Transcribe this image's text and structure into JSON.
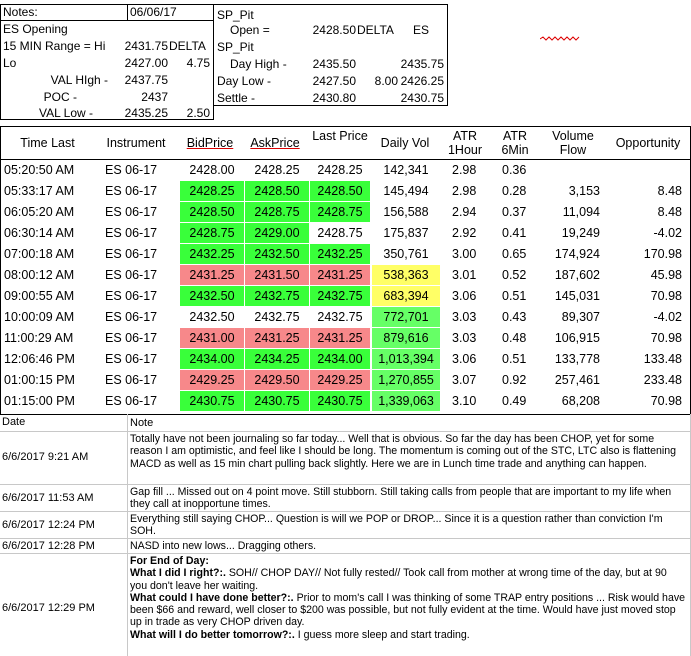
{
  "header": {
    "notes_label": "Notes:",
    "date": "06/06/17",
    "left": [
      {
        "label": "ES Opening",
        "v1": "",
        "v2": ""
      },
      {
        "label": "15 MIN Range = Hi",
        "v1": "2431.75",
        "v2": "DELTA"
      },
      {
        "label": "Lo",
        "v1": "2427.00",
        "v2": "4.75"
      },
      {
        "label": "VAL HIgh  -",
        "v1": "2437.75",
        "v2": ""
      },
      {
        "label": "POC  -",
        "v1": "2437",
        "v2": ""
      },
      {
        "label": "VAL Low  -",
        "v1": "2435.25",
        "v2": "2.50"
      }
    ],
    "right": {
      "title": "SP_Pit",
      "open_label": "Open =",
      "open_value": "2428.50",
      "delta_label": "DELTA",
      "es_label": "ES",
      "title2": "SP_Pit",
      "rows": [
        {
          "label": "Day High -",
          "v1": "2435.50",
          "v2": "",
          "v3": "2435.75"
        },
        {
          "label": "Day Low -",
          "v1": "2427.50",
          "v2": "8.00",
          "v3": "2426.25"
        },
        {
          "label": "Settle -",
          "v1": "2430.80",
          "v2": "",
          "v3": "2430.75"
        }
      ]
    }
  },
  "quotes": {
    "columns": [
      "Time Last",
      "Instrument",
      "BidPrice",
      "AskPrice",
      "Last Price",
      "Daily Vol",
      "ATR 1Hour",
      "ATR 6Min",
      "Volume Flow",
      "Opportunity"
    ],
    "rows": [
      {
        "time": "05:20:50 AM",
        "inst": "ES 06-17",
        "bid": "2428.00",
        "ask": "2428.25",
        "last": "2428.25",
        "vol": "142,341",
        "atr1": "2.98",
        "atr6": "0.36",
        "flow": "",
        "opp": "",
        "c": [
          "",
          "",
          "",
          ""
        ]
      },
      {
        "time": "05:33:17 AM",
        "inst": "ES 06-17",
        "bid": "2428.25",
        "ask": "2428.50",
        "last": "2428.50",
        "vol": "145,494",
        "atr1": "2.98",
        "atr6": "0.28",
        "flow": "3,153",
        "opp": "8.48",
        "c": [
          "green",
          "green",
          "green",
          ""
        ]
      },
      {
        "time": "06:05:20 AM",
        "inst": "ES 06-17",
        "bid": "2428.50",
        "ask": "2428.75",
        "last": "2428.75",
        "vol": "156,588",
        "atr1": "2.94",
        "atr6": "0.37",
        "flow": "11,094",
        "opp": "8.48",
        "c": [
          "green",
          "green",
          "green",
          ""
        ]
      },
      {
        "time": "06:30:14 AM",
        "inst": "ES 06-17",
        "bid": "2428.75",
        "ask": "2429.00",
        "last": "2428.75",
        "vol": "175,837",
        "atr1": "2.92",
        "atr6": "0.41",
        "flow": "19,249",
        "opp": "-4.02",
        "c": [
          "green",
          "green",
          "",
          ""
        ]
      },
      {
        "time": "07:00:18 AM",
        "inst": "ES 06-17",
        "bid": "2432.25",
        "ask": "2432.50",
        "last": "2432.25",
        "vol": "350,761",
        "atr1": "3.00",
        "atr6": "0.65",
        "flow": "174,924",
        "opp": "170.98",
        "c": [
          "green",
          "green",
          "green",
          ""
        ]
      },
      {
        "time": "08:00:12 AM",
        "inst": "ES 06-17",
        "bid": "2431.25",
        "ask": "2431.50",
        "last": "2431.25",
        "vol": "538,363",
        "atr1": "3.01",
        "atr6": "0.52",
        "flow": "187,602",
        "opp": "45.98",
        "c": [
          "red",
          "red",
          "red",
          "yellow"
        ]
      },
      {
        "time": "09:00:55 AM",
        "inst": "ES 06-17",
        "bid": "2432.50",
        "ask": "2432.75",
        "last": "2432.75",
        "vol": "683,394",
        "atr1": "3.06",
        "atr6": "0.51",
        "flow": "145,031",
        "opp": "70.98",
        "c": [
          "green",
          "green",
          "green",
          "yellow"
        ]
      },
      {
        "time": "10:00:09 AM",
        "inst": "ES 06-17",
        "bid": "2432.50",
        "ask": "2432.75",
        "last": "2432.75",
        "vol": "772,701",
        "atr1": "3.03",
        "atr6": "0.43",
        "flow": "89,307",
        "opp": "-4.02",
        "c": [
          "",
          "",
          "",
          "lgreen"
        ]
      },
      {
        "time": "11:00:29 AM",
        "inst": "ES 06-17",
        "bid": "2431.00",
        "ask": "2431.25",
        "last": "2431.25",
        "vol": "879,616",
        "atr1": "3.03",
        "atr6": "0.48",
        "flow": "106,915",
        "opp": "70.98",
        "c": [
          "red",
          "red",
          "red",
          "lgreen"
        ]
      },
      {
        "time": "12:06:46 PM",
        "inst": "ES 06-17",
        "bid": "2434.00",
        "ask": "2434.25",
        "last": "2434.00",
        "vol": "1,013,394",
        "atr1": "3.06",
        "atr6": "0.51",
        "flow": "133,778",
        "opp": "133.48",
        "c": [
          "green",
          "green",
          "green",
          "lgreen"
        ]
      },
      {
        "time": "01:00:15 PM",
        "inst": "ES 06-17",
        "bid": "2429.25",
        "ask": "2429.50",
        "last": "2429.25",
        "vol": "1,270,855",
        "atr1": "3.07",
        "atr6": "0.92",
        "flow": "257,461",
        "opp": "233.48",
        "c": [
          "red",
          "red",
          "red",
          "lgreen"
        ]
      },
      {
        "time": "01:15:00 PM",
        "inst": "ES 06-17",
        "bid": "2430.75",
        "ask": "2430.75",
        "last": "2430.75",
        "vol": "1,339,063",
        "atr1": "3.10",
        "atr6": "0.49",
        "flow": "68,208",
        "opp": "70.98",
        "c": [
          "green",
          "green",
          "green",
          "lgreen"
        ]
      }
    ]
  },
  "journal": {
    "date_header": "Date",
    "note_header": "Note",
    "entries": [
      {
        "date": "6/6/2017 9:21 AM",
        "text": "Totally have not been journaling so far today... Well that is obvious.  So far the day has been CHOP, yet for some reason I am optimistic, and feel like I should be long.  The momentum is coming out of the STC, LTC also is flattening MACD as well as 15 min chart pulling back slightly.  Here we are in Lunch time trade and anything can happen."
      },
      {
        "date": "6/6/2017 11:53 AM",
        "text": "Gap fill ... Missed out on 4 point move.  Still stubborn.  Still taking calls from people that are important to my life when they call at inopportune times."
      },
      {
        "date": "6/6/2017 12:24 PM",
        "text": "Everything still saying CHOP... Question is will we POP or DROP... Since it is a question rather than conviction I'm SOH."
      },
      {
        "date": "6/6/2017 12:28 PM",
        "text": "NASD into new lows... Dragging others."
      },
      {
        "date": "6/6/2017 12:29 PM",
        "eod_title": "For End of Day:",
        "q1": "What I did I right?:.",
        "a1": " SOH// CHOP DAY// Not fully rested// Took call from mother at wrong time of the day, but at 90 you don't leave her waiting.",
        "q2": "What could I have done better?:.",
        "a2": "  Prior to mom's call I was thinking of some TRAP entry positions ... Risk would have been $66 and reward, well closer to $200 was possible, but not fully evident at the time.  Would have just moved stop up in trade as very CHOP driven day.",
        "q3": "What will I do better tomorrow?:.",
        "a3": " I guess more sleep and start trading."
      }
    ]
  }
}
